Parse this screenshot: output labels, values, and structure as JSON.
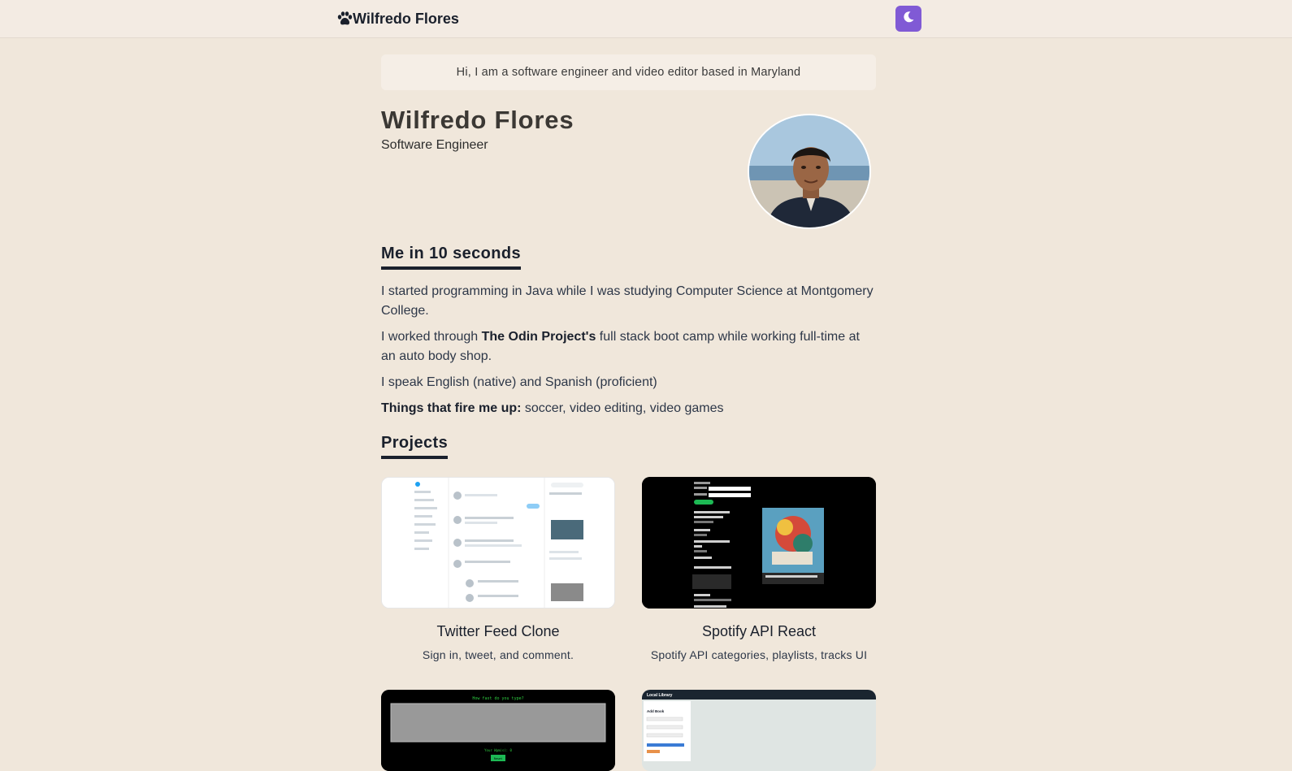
{
  "navbar": {
    "brand_text": "Wilfredo Flores",
    "brand_icon": "paw-icon",
    "theme_toggle_icon": "moon-icon",
    "theme_toggle_color": "#805ad5"
  },
  "intro": {
    "text": "Hi, I am a software engineer and video editor based in Maryland"
  },
  "hero": {
    "name": "Wilfredo Flores",
    "role": "Software Engineer"
  },
  "about": {
    "title": "Me in 10 seconds",
    "p1": "I started programming in Java while I was studying Computer Science at Montgomery College.",
    "p2_before": "I worked through ",
    "p2_bold": "The Odin Project's",
    "p2_after": " full stack boot camp while working full-time at an auto body shop.",
    "p3": "I speak English (native) and Spanish (proficient)",
    "p4_bold": "Things that fire me up:",
    "p4_rest": " soccer, video editing, video games"
  },
  "projects": {
    "title": "Projects",
    "items": [
      {
        "title": "Twitter Feed Clone",
        "description": "Sign in, tweet, and comment."
      },
      {
        "title": "Spotify API React",
        "description": "Spotify API categories, playlists, tracks UI"
      }
    ],
    "thumb_text": {
      "typing_heading": "How fast do you type?",
      "typing_wpm": "Your Wpm(s): 0",
      "typing_button": "Reset",
      "library_header": "Local Library",
      "library_form_title": "Add Book"
    }
  }
}
